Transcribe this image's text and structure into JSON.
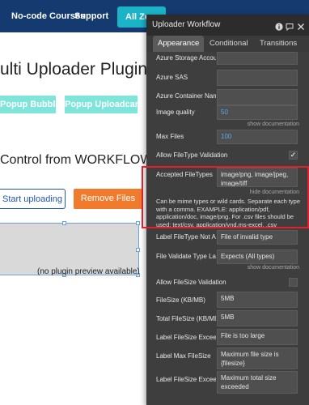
{
  "nav": {
    "courses": "No-code Courses",
    "support": "Support",
    "cta": "All Zen"
  },
  "page": {
    "title": "ulti Uploader Plugin",
    "btn_bubble": "Popup Bubble",
    "btn_uploadcare": "Popup Uploadcare",
    "section_title": "Control from WORKFLOW",
    "start_uploading": "Start uploading",
    "remove_files": "Remove Files",
    "plugin_caption": "(no plugin preview available)"
  },
  "panel": {
    "title": "Uploader Workflow",
    "icons": [
      "info-icon",
      "comment-icon",
      "close-icon"
    ],
    "tabs": {
      "appearance": "Appearance",
      "conditional": "Conditional",
      "transitions": "Transitions"
    },
    "fields": {
      "azure_storage": {
        "label": "Azure Storage Accoun",
        "value": ""
      },
      "azure_sas": {
        "label": "Azure SAS",
        "value": ""
      },
      "azure_container": {
        "label": "Azure Container Nam",
        "value": ""
      },
      "image_quality": {
        "label": "Image quality",
        "value": "50"
      },
      "max_files": {
        "label": "Max Files",
        "value": "100"
      },
      "allow_filetype": {
        "label": "Allow FileType Validation",
        "checked": true
      },
      "accepted_filetypes": {
        "label": "Accepted FileTypes",
        "value": "image/png, image/jpeg, image/tiff",
        "help": "Can be mime types or wild cards. Separate each type with a comma. EXAMPLE: application/pdf, application/doc, image/png. For .csv files should be used: text/csv, application/vnd.ms-excel, .csv"
      },
      "label_filetype_not_all": {
        "label": "Label FileType Not All",
        "value": "File of invalid type"
      },
      "file_validate_type": {
        "label": "File Validate Type Lab",
        "value": "Expects (All types)"
      },
      "allow_filesize": {
        "label": "Allow FileSize Validation",
        "checked": false
      },
      "filesize": {
        "label": "FileSize (KB/MB)",
        "value": "5MB"
      },
      "total_filesize": {
        "label": "Total FileSize (KB/MB)",
        "value": "5MB"
      },
      "label_filesize_exceeded": {
        "label": "Label FileSize Exceede",
        "value": "File is too large"
      },
      "label_max_filesize": {
        "label": "Label Max FileSize",
        "value": "Maximum file size is {filesize}"
      },
      "label_filesize_exceeded_total": {
        "label": "Label FileSize Exceede",
        "value": "Maximum total size exceeded"
      }
    },
    "show_documentation": "show documentation",
    "hide_documentation": "hide documentation"
  },
  "colors": {
    "navbar": "#153a6f",
    "teal": "#7fe5da",
    "orange": "#f07b2c",
    "panel_bg": "#3e3e3e",
    "highlight": "#e3202a",
    "dynamic_value": "#5aa8e8"
  }
}
